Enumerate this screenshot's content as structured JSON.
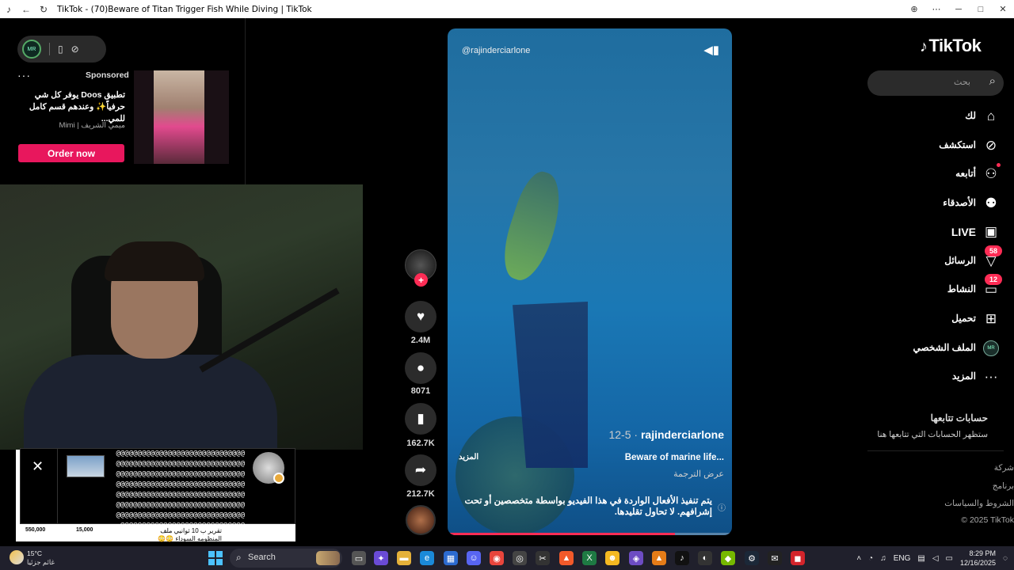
{
  "window": {
    "title": "TikTok - (70)Beware of Titan Trigger Fish While Diving | TikTok"
  },
  "ad": {
    "sponsored_label": "Sponsored",
    "headline": "تطبيق Doos يوفر كل شي حرفياً✨ وعندهم قسم كامل للمي...",
    "brand": "Mimi | ميمي الشريف",
    "cta_label": "Order now"
  },
  "chat_overlay": {
    "message": "@@@@@@@@@@@@@@@@@@@@@@@@@@@@@@@@@@@@@@@@@@@@@@@@@@@@@@@@@@@@@@@@@@@@@@@@@@@@@@@@@@@@@@@@@@@@@@@@@@@@@@@@@@@@@@@@@@@@@@@@@@@@@@@@@@@@@@@@@@@@@@@@@@@@@@@@@@@@@@@@@@@@@@@@@@@@@@@@@@@@@@@@@@@@@@@@@@@@@@@@@@@@@@@@@@@@@@@@@@@@@@@@@@@@@@@@@@@@@@@",
    "price_1": "550,000",
    "price_2": "15,000",
    "news": "تقرير ب 10 ثوانيي ملف المنظومه السوداء 😳😳"
  },
  "actions": {
    "likes": "2.4M",
    "comments": "8071",
    "bookmarks": "162.7K",
    "shares": "212.7K"
  },
  "video": {
    "watermark_handle": "@rajinderciarlone",
    "author": "rajinderciarlone",
    "date": "12-5 ·",
    "caption": "Beware of marine life...",
    "more_label": "المزيد",
    "translate_label": "عرض الترجمة",
    "warning": "يتم تنفيذ الأفعال الواردة في هذا الفيديو بواسطة متخصصين أو تحت إشرافهم. لا تحاول تقليدها.",
    "progress": 0.8
  },
  "sidebar": {
    "logo_text": "TikTok",
    "search_placeholder": "بحث",
    "nav": [
      {
        "label": "لك",
        "icon": "home-icon"
      },
      {
        "label": "استكشف",
        "icon": "compass-icon"
      },
      {
        "label": "أتابعه",
        "icon": "following-icon"
      },
      {
        "label": "الأصدقاء",
        "icon": "friends-icon"
      },
      {
        "label": "LIVE",
        "icon": "live-icon"
      },
      {
        "label": "الرسائل",
        "icon": "messages-icon",
        "badge": "58"
      },
      {
        "label": "النشاط",
        "icon": "activity-icon",
        "badge": "12"
      },
      {
        "label": "تحميل",
        "icon": "upload-icon"
      },
      {
        "label": "الملف الشخصي",
        "icon": "profile-avatar"
      },
      {
        "label": "المزيد",
        "icon": "more-icon"
      }
    ],
    "following_title": "حسابات تتابعها",
    "following_sub": "ستظهر الحسابات التي تتابعها هنا",
    "footer": [
      "شركة",
      "برنامج",
      "الشروط والسياسات",
      "© 2025 TikTok"
    ]
  },
  "taskbar": {
    "temperature": "15°C",
    "condition": "غائم جزئيا",
    "search_label": "Search",
    "language": "ENG",
    "time": "8:29 PM",
    "date": "12/16/2025"
  },
  "colors": {
    "accent": "#fe2c55",
    "ad_cta": "#e8175d"
  }
}
